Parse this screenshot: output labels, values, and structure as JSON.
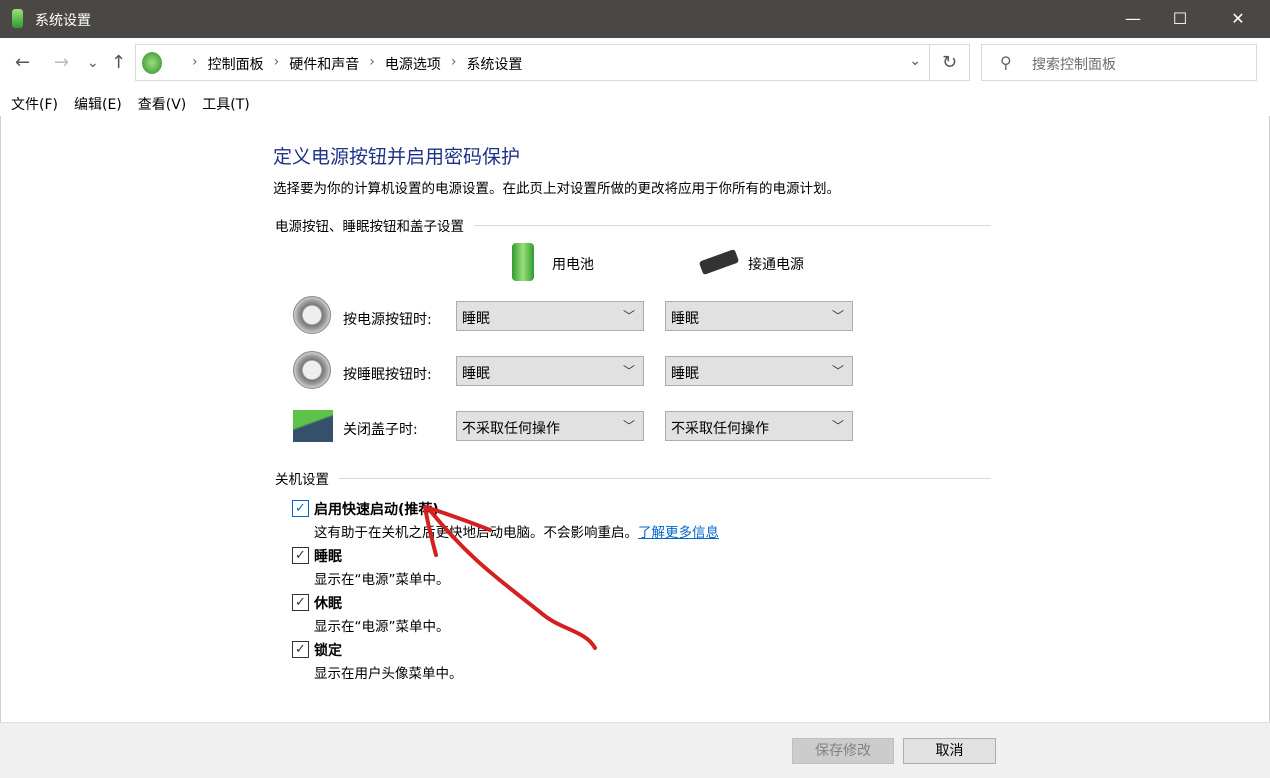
{
  "window": {
    "title": "系统设置",
    "minimize": "—",
    "maximize": "☐",
    "close": "✕"
  },
  "nav": {
    "back": "←",
    "forward": "→",
    "recent": "⌄",
    "up": "↑",
    "breadcrumbs": [
      "控制面板",
      "硬件和声音",
      "电源选项",
      "系统设置"
    ],
    "refresh": "↻",
    "dropdown": "⌄"
  },
  "search": {
    "placeholder": "搜索控制面板",
    "icon": "⚲"
  },
  "menu": [
    "文件(F)",
    "编辑(E)",
    "查看(V)",
    "工具(T)"
  ],
  "page": {
    "title": "定义电源按钮并启用密码保护",
    "description": "选择要为你的计算机设置的电源设置。在此页上对设置所做的更改将应用于你所有的电源计划。"
  },
  "power_section": {
    "heading": "电源按钮、睡眠按钮和盖子设置",
    "columns": [
      "用电池",
      "接通电源"
    ],
    "rows": [
      {
        "label": "按电源按钮时:",
        "battery": "睡眠",
        "plugged": "睡眠"
      },
      {
        "label": "按睡眠按钮时:",
        "battery": "睡眠",
        "plugged": "睡眠"
      },
      {
        "label": "关闭盖子时:",
        "battery": "不采取任何操作",
        "plugged": "不采取任何操作"
      }
    ]
  },
  "shutdown_section": {
    "heading": "关机设置",
    "items": [
      {
        "label": "启用快速启动(推荐)",
        "desc": "这有助于在关机之后更快地启动电脑。不会影响重启。",
        "link": "了解更多信息",
        "checked": true
      },
      {
        "label": "睡眠",
        "desc": "显示在“电源”菜单中。",
        "checked": true
      },
      {
        "label": "休眠",
        "desc": "显示在“电源”菜单中。",
        "checked": true
      },
      {
        "label": "锁定",
        "desc": "显示在用户头像菜单中。",
        "checked": true
      }
    ]
  },
  "footer": {
    "save": "保存修改",
    "cancel": "取消"
  },
  "annotation_color": "#d42020"
}
